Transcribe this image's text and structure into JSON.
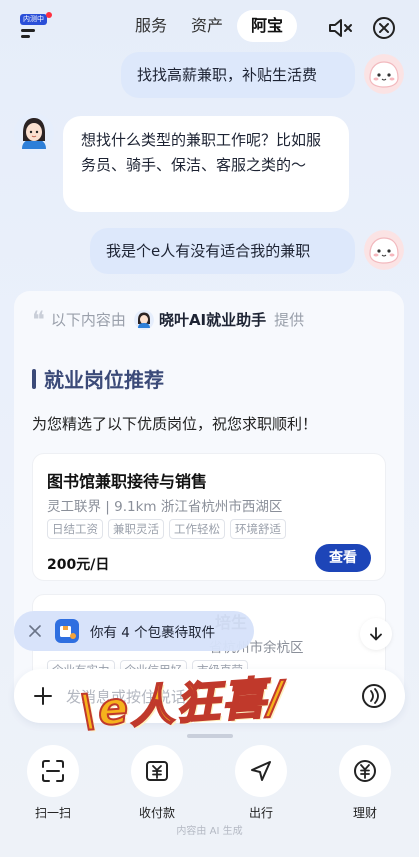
{
  "topbar": {
    "badge_text": "内测中",
    "tabs": [
      {
        "label": "服务"
      },
      {
        "label": "资产"
      },
      {
        "label": "阿宝"
      }
    ]
  },
  "chat": {
    "user_msg_1": "找找高薪兼职，补贴生活费",
    "bot_msg_1": "想找什么类型的兼职工作呢？比如服务员、骑手、保洁、客服之类的～",
    "user_msg_2": "我是个e人有没有适合我的兼职"
  },
  "result": {
    "provider_prefix": "以下内容由",
    "provider_name": "晓叶AI就业助手",
    "provider_suffix": "提供",
    "section_title": "就业岗位推荐",
    "intro": "为您精选了以下优质岗位，祝您求职顺利！",
    "jobs": [
      {
        "title": "图书馆兼职接待与销售",
        "meta": "灵工联界 | 9.1km  浙江省杭州市西湖区",
        "tags": [
          "日结工资",
          "兼职灵活",
          "工作轻松",
          "环境舒适"
        ],
        "salary": "200元/日",
        "action": "查看"
      },
      {
        "title_partial": "培生",
        "meta_partial": "省杭州市余杭区",
        "tags": [
          "企业有实力",
          "企业信用好",
          "市级直营"
        ]
      }
    ]
  },
  "package_banner": {
    "text": "你有 4 个包裹待取件"
  },
  "input": {
    "placeholder": "发消息或按住说话..."
  },
  "sticker": {
    "text": "\\e人狂喜/"
  },
  "quick_actions": [
    {
      "label": "扫一扫",
      "icon": "scan-icon"
    },
    {
      "label": "收付款",
      "icon": "payment-icon"
    },
    {
      "label": "出行",
      "icon": "navigation-icon"
    },
    {
      "label": "理财",
      "icon": "finance-icon"
    }
  ],
  "footer_note": "内容由 AI 生成",
  "colors": {
    "accent": "#1d45b8",
    "user_bubble": "#dde8fb",
    "section_title": "#3b4a78",
    "sticker_fill": "#f6b21c"
  }
}
